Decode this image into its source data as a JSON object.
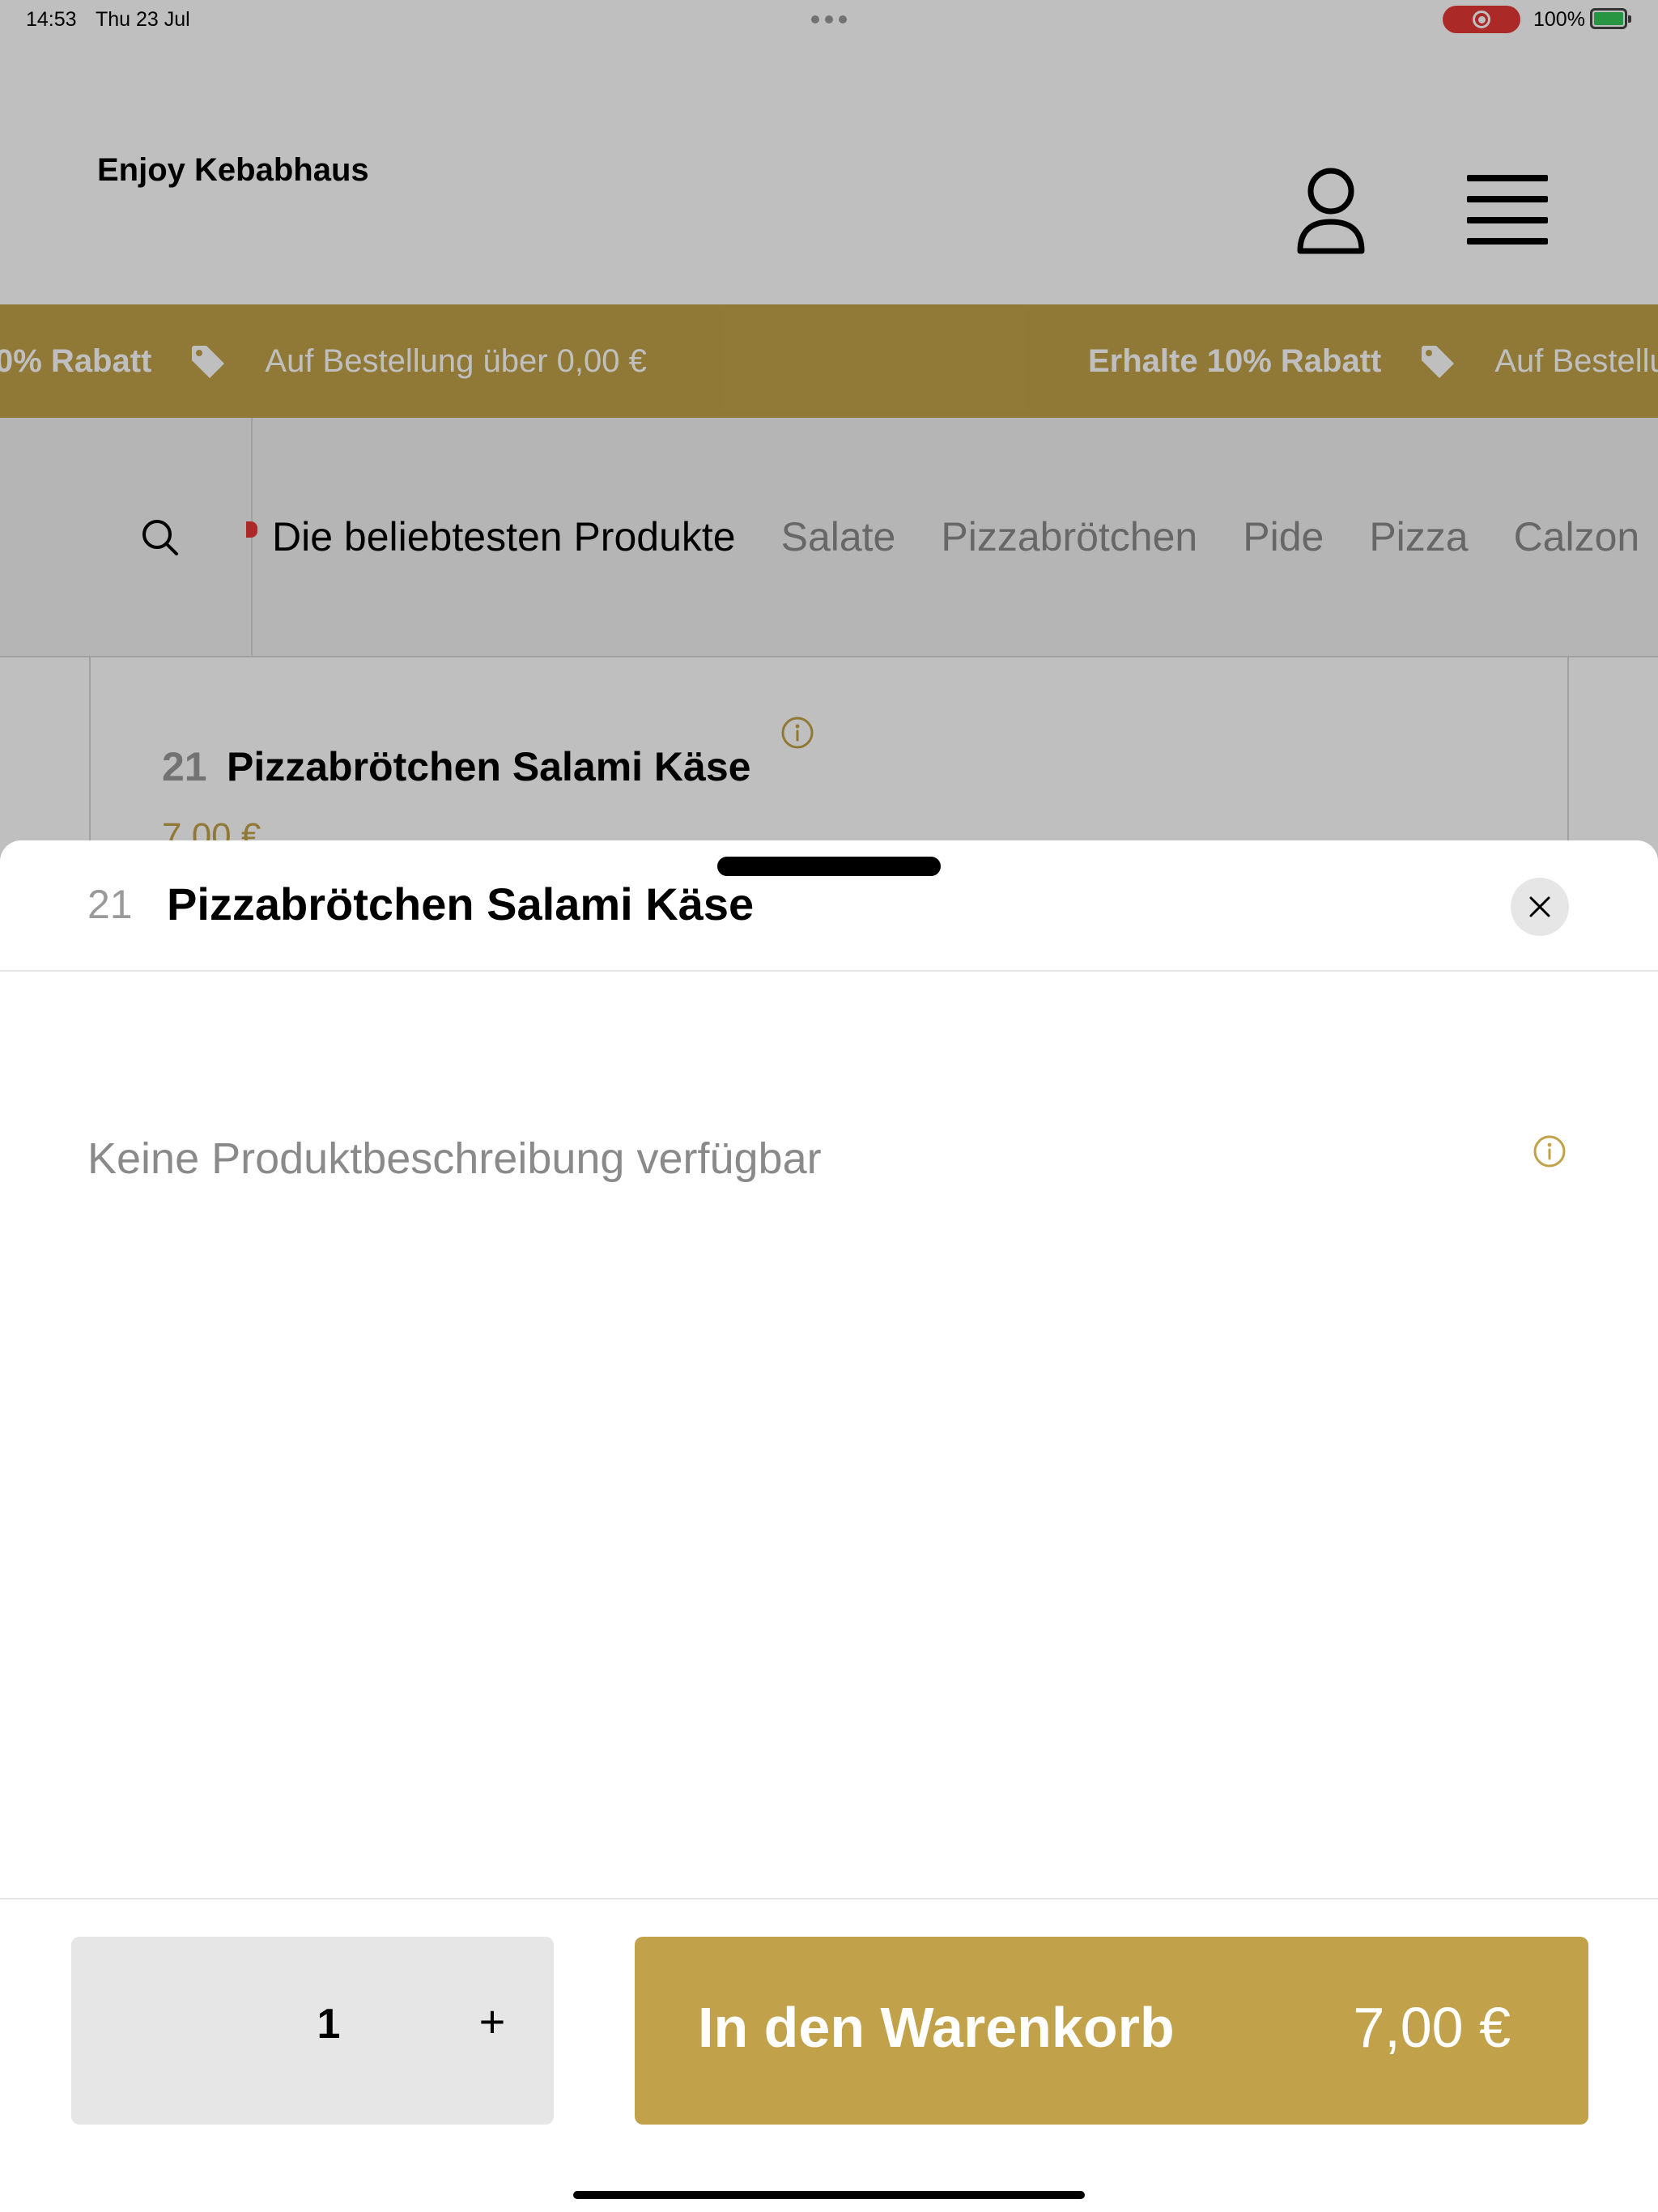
{
  "status_bar": {
    "time": "14:53",
    "date": "Thu 23 Jul",
    "battery": "100%"
  },
  "header": {
    "brand": "Enjoy Kebabhaus",
    "user_icon": "user-icon",
    "menu_icon": "hamburger-menu-icon"
  },
  "promo": {
    "partial_bold": "0% Rabatt",
    "item1_text": "Auf Bestellung über 0,00 €",
    "item2_bold": "Erhalte 10% Rabatt",
    "item2_partial_text": "Auf Bestellu",
    "color": "#c1a24a"
  },
  "categories": {
    "active": "Die beliebtesten Produkte",
    "items": [
      "Salate",
      "Pizzabrötchen",
      "Pide",
      "Pizza",
      "Calzon"
    ]
  },
  "background_product": {
    "number": "21",
    "title": "Pizzabrötchen Salami Käse",
    "price": "7,00 €"
  },
  "sheet": {
    "number": "21",
    "title": "Pizzabrötchen Salami Käse",
    "description": "Keine Produktbeschreibung verfügbar",
    "quantity": "1",
    "plus": "+",
    "cart_label": "In den Warenkorb",
    "cart_price": "7,00 €",
    "accent_color": "#c1a24a"
  }
}
